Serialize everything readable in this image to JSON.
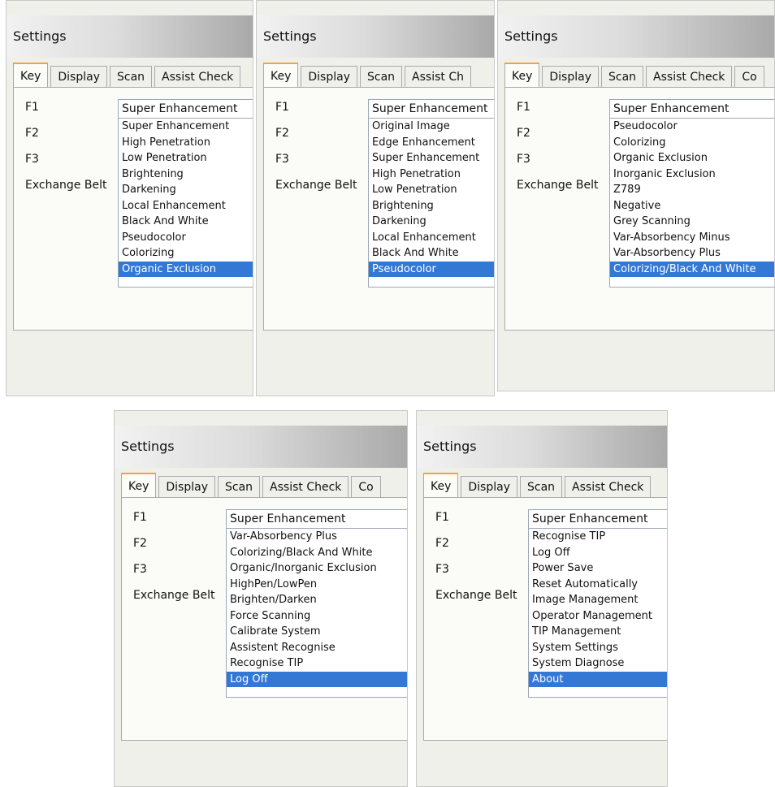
{
  "panels": [
    {
      "title": "Settings",
      "tabs": [
        "Key",
        "Display",
        "Scan",
        "Assist Check"
      ],
      "labels": [
        "F1",
        "F2",
        "F3",
        "Exchange Belt"
      ],
      "selected": "Super Enhancement",
      "options": [
        "Super Enhancement",
        "High Penetration",
        "Low Penetration",
        "Brightening",
        "Darkening",
        "Local Enhancement",
        "Black And White",
        "Pseudocolor",
        "Colorizing",
        "Organic Exclusion"
      ]
    },
    {
      "title": "Settings",
      "tabs": [
        "Key",
        "Display",
        "Scan",
        "Assist Ch"
      ],
      "labels": [
        "F1",
        "F2",
        "F3",
        "Exchange Belt"
      ],
      "selected": "Super Enhancement",
      "options": [
        "Original Image",
        "Edge Enhancement",
        "Super Enhancement",
        "High Penetration",
        "Low Penetration",
        "Brightening",
        "Darkening",
        "Local Enhancement",
        "Black And White",
        "Pseudocolor"
      ]
    },
    {
      "title": "Settings",
      "tabs": [
        "Key",
        "Display",
        "Scan",
        "Assist Check",
        "Co"
      ],
      "labels": [
        "F1",
        "F2",
        "F3",
        "Exchange Belt"
      ],
      "selected": "Super Enhancement",
      "options": [
        "Pseudocolor",
        "Colorizing",
        "Organic Exclusion",
        "Inorganic Exclusion",
        "Z789",
        "Negative",
        "Grey Scanning",
        "Var-Absorbency Minus",
        "Var-Absorbency Plus",
        "Colorizing/Black And White"
      ]
    },
    {
      "title": "Settings",
      "tabs": [
        "Key",
        "Display",
        "Scan",
        "Assist Check",
        "Co"
      ],
      "labels": [
        "F1",
        "F2",
        "F3",
        "Exchange Belt"
      ],
      "selected": "Super Enhancement",
      "options": [
        "Var-Absorbency Plus",
        "Colorizing/Black And White",
        "Organic/Inorganic Exclusion",
        "HighPen/LowPen",
        "Brighten/Darken",
        "Force Scanning",
        "Calibrate System",
        "Assistent Recognise",
        "Recognise TIP",
        "Log Off"
      ]
    },
    {
      "title": "Settings",
      "tabs": [
        "Key",
        "Display",
        "Scan",
        "Assist Check"
      ],
      "labels": [
        "F1",
        "F2",
        "F3",
        "Exchange Belt"
      ],
      "selected": "Super Enhancement",
      "options": [
        "Recognise TIP",
        "Log Off",
        "Power Save",
        "Reset Automatically",
        "Image Management",
        "Operator Management",
        "TIP Management",
        "System Settings",
        "System Diagnose",
        "About"
      ]
    }
  ]
}
